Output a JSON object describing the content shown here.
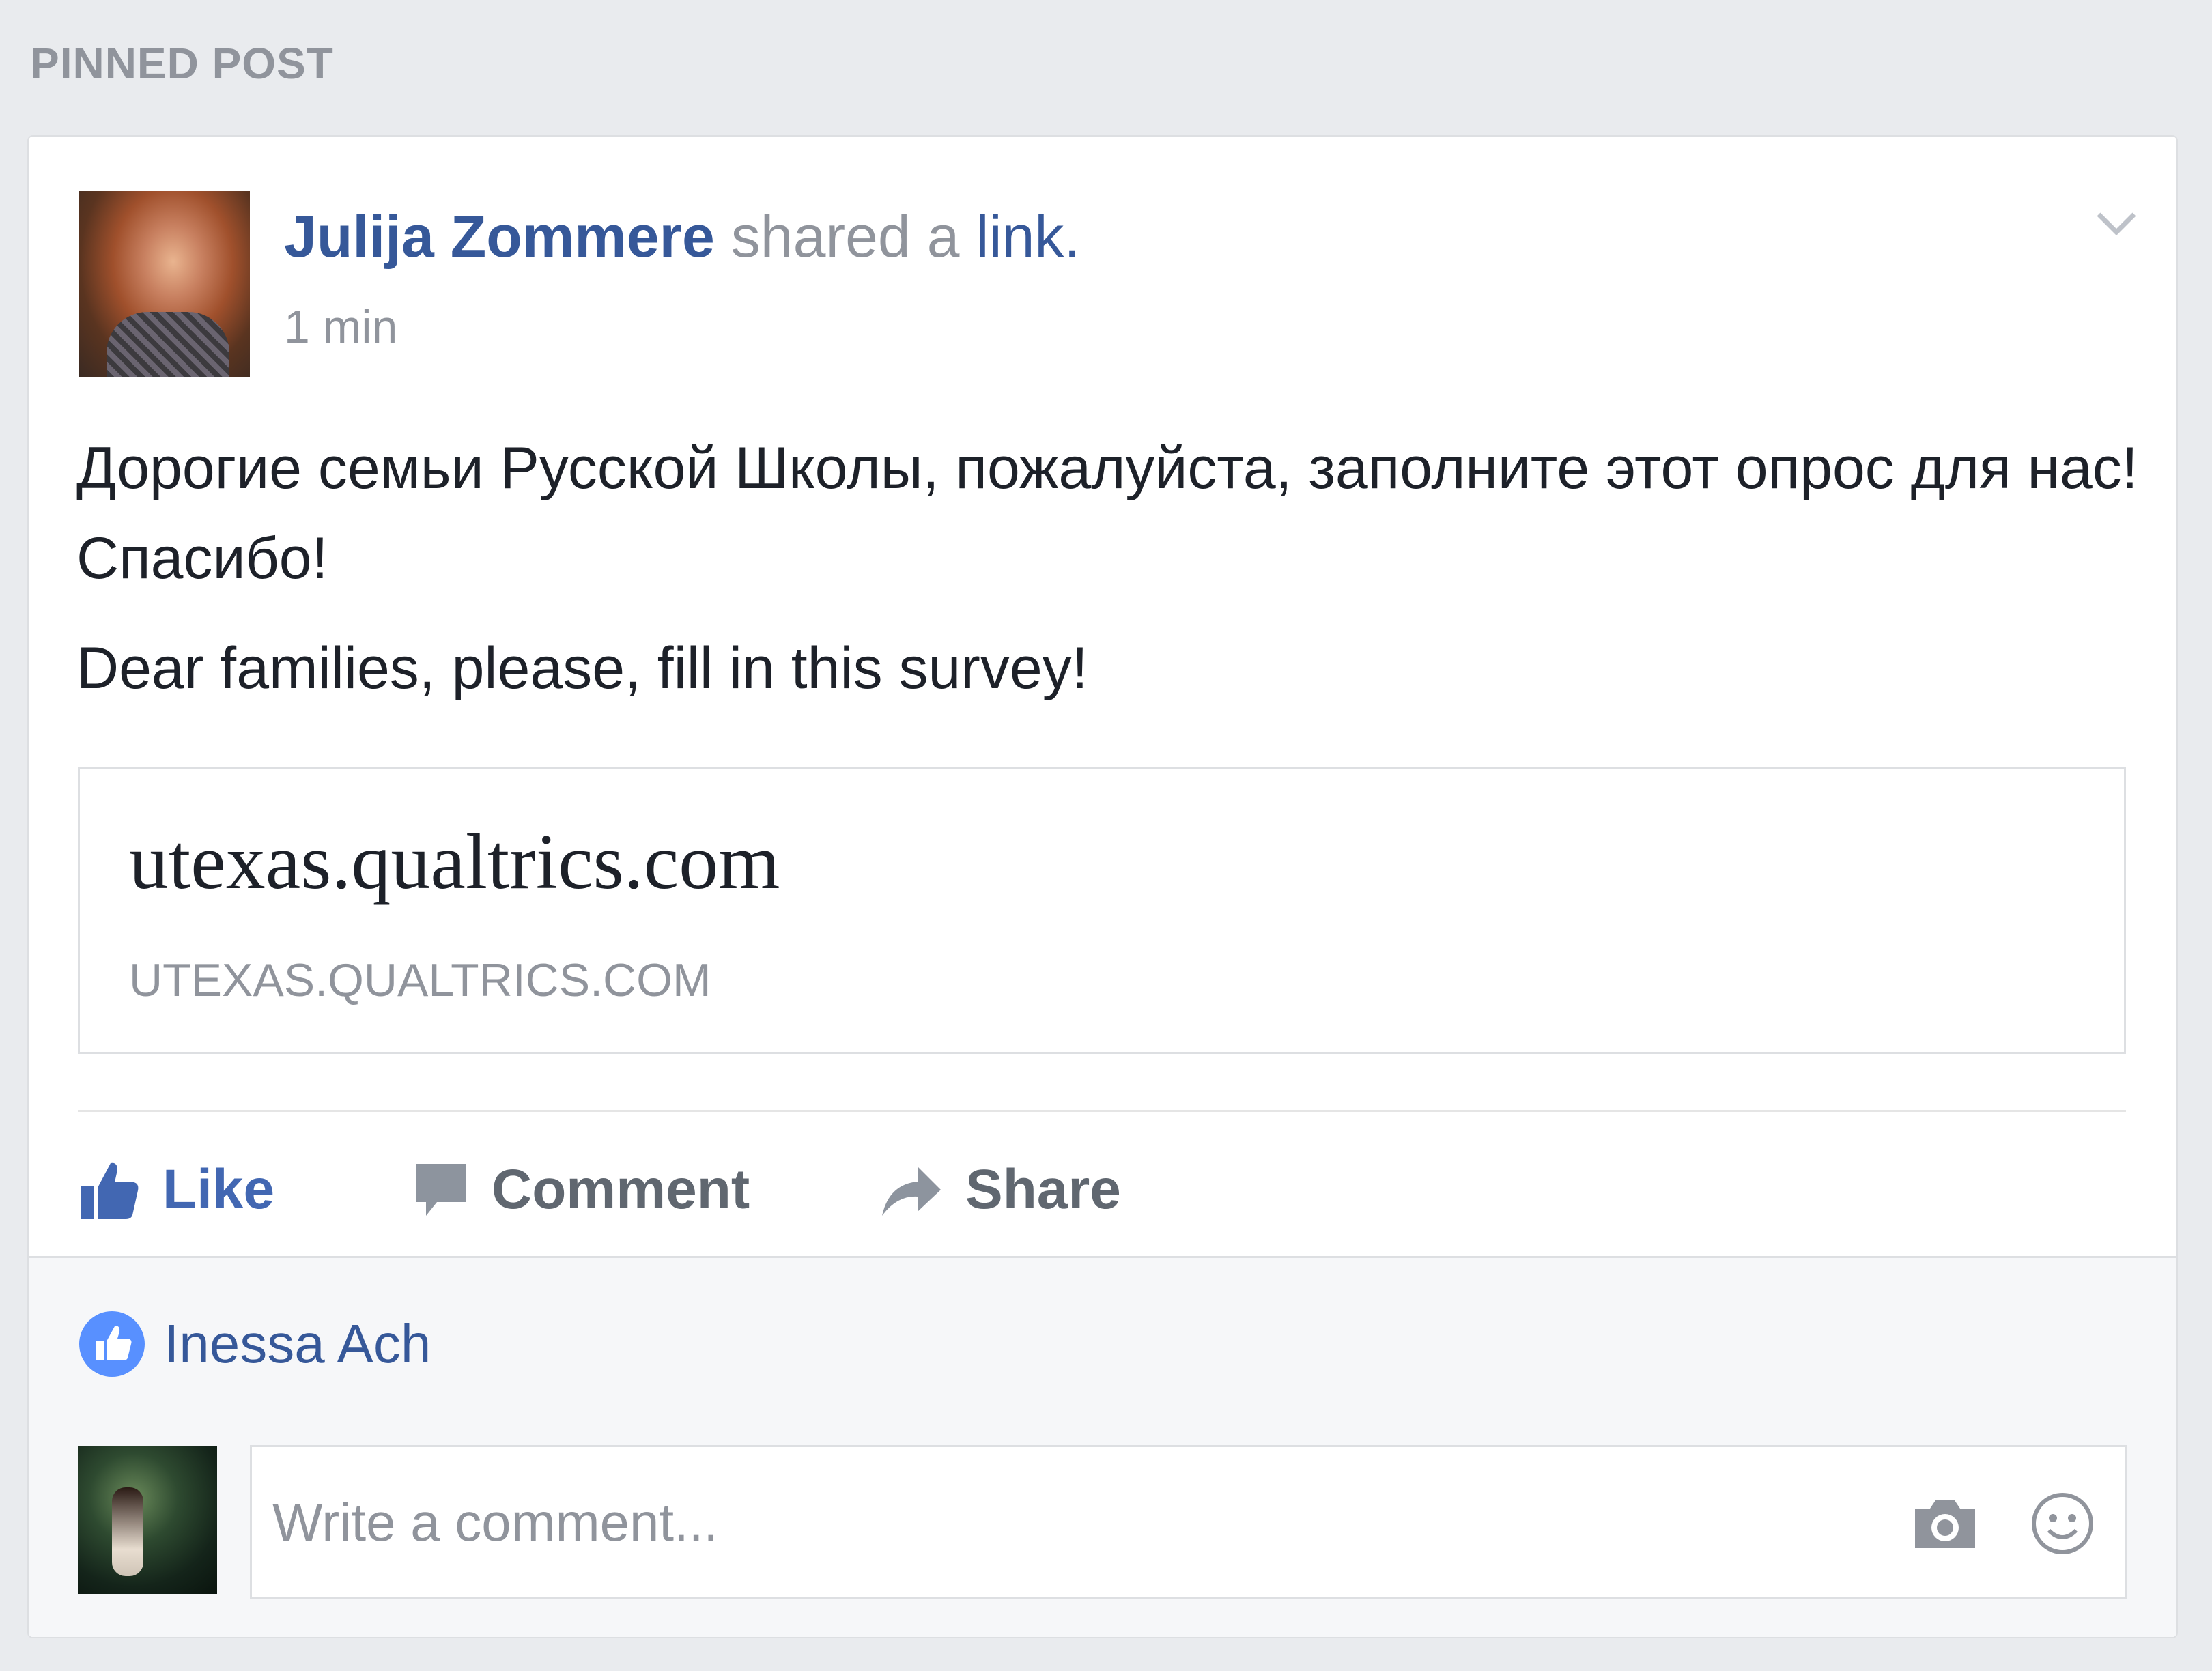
{
  "section": {
    "label": "PINNED POST"
  },
  "post": {
    "author": "Julija Zommere",
    "action_text": "shared a",
    "action_link": "link.",
    "time": "1 min",
    "text_ru": "Дорогие семьи Русской Школы, пожалуйста, заполните этот опрос для нас! Спасибо!",
    "text_en": "Dear families, please, fill in this survey!",
    "link_preview": {
      "title": "utexas.qualtrics.com",
      "domain": "UTEXAS.QUALTRICS.COM"
    }
  },
  "actions": {
    "like_label": "Like",
    "comment_label": "Comment",
    "share_label": "Share"
  },
  "reactions": {
    "liker_name": "Inessa Ach"
  },
  "comment_input": {
    "placeholder": "Write a comment...",
    "value": ""
  },
  "icons": {
    "options": "chevron-down-icon",
    "like": "thumbs-up-icon",
    "comment": "speech-bubble-icon",
    "share": "share-arrow-icon",
    "reaction": "like-reaction-icon",
    "camera": "camera-icon",
    "emoji": "smiley-icon"
  },
  "colors": {
    "link_blue": "#365899",
    "like_blue": "#4267b2",
    "text": "#1d2129",
    "muted": "#90949c",
    "background": "#e9ebee"
  }
}
